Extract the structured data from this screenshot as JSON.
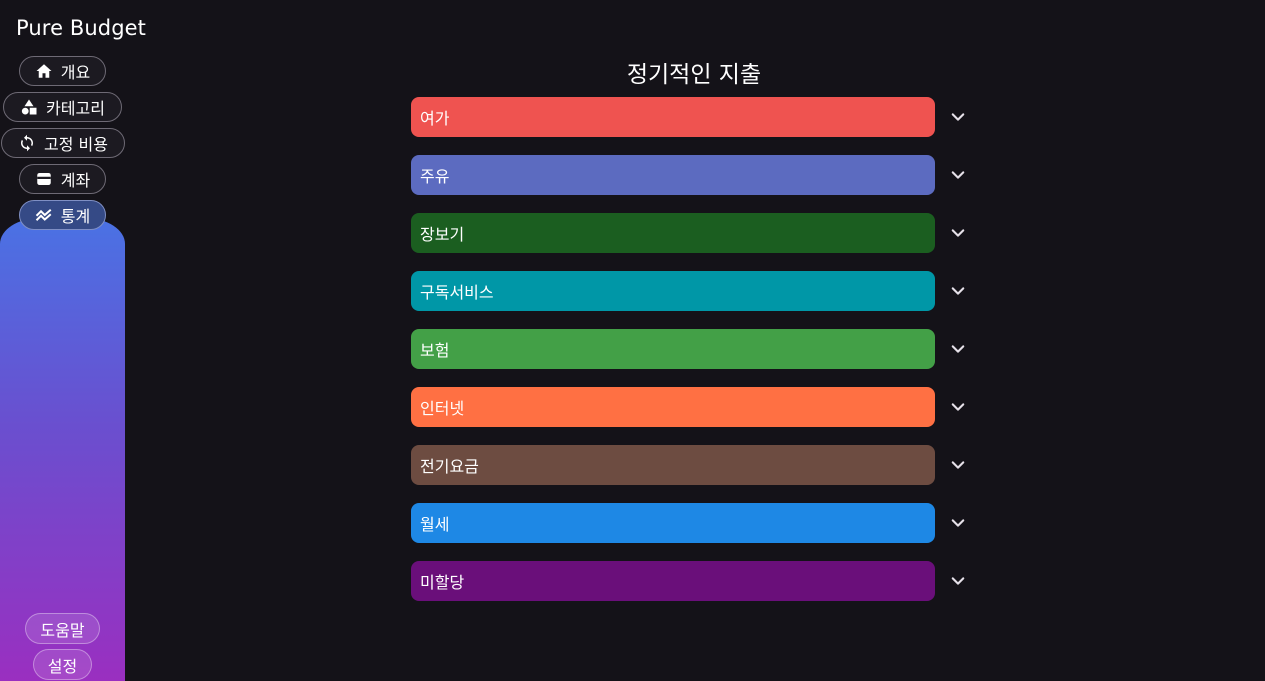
{
  "app": {
    "title": "Pure Budget"
  },
  "nav": {
    "overview": "개요",
    "categories": "카테고리",
    "fixed_costs": "고정 비용",
    "accounts": "계좌",
    "statistics": "통계"
  },
  "bottom_nav": {
    "help": "도움말",
    "settings": "설정"
  },
  "page": {
    "title": "정기적인 지출"
  },
  "categories": [
    {
      "name": "여가",
      "color": "#ef5350"
    },
    {
      "name": "주유",
      "color": "#5c6bc0"
    },
    {
      "name": "장보기",
      "color": "#1b5e20"
    },
    {
      "name": "구독서비스",
      "color": "#0097a7"
    },
    {
      "name": "보험",
      "color": "#43a047"
    },
    {
      "name": "인터넷",
      "color": "#ff7043"
    },
    {
      "name": "전기요금",
      "color": "#6d4c41"
    },
    {
      "name": "월세",
      "color": "#1e88e5"
    },
    {
      "name": "미할당",
      "color": "#6a0f7a"
    }
  ],
  "icons": {
    "overview": "home-icon",
    "categories": "shapes-icon",
    "fixed_costs": "sync-icon",
    "accounts": "wallet-icon",
    "statistics": "trending-icon",
    "expand": "chevron-down-icon"
  }
}
